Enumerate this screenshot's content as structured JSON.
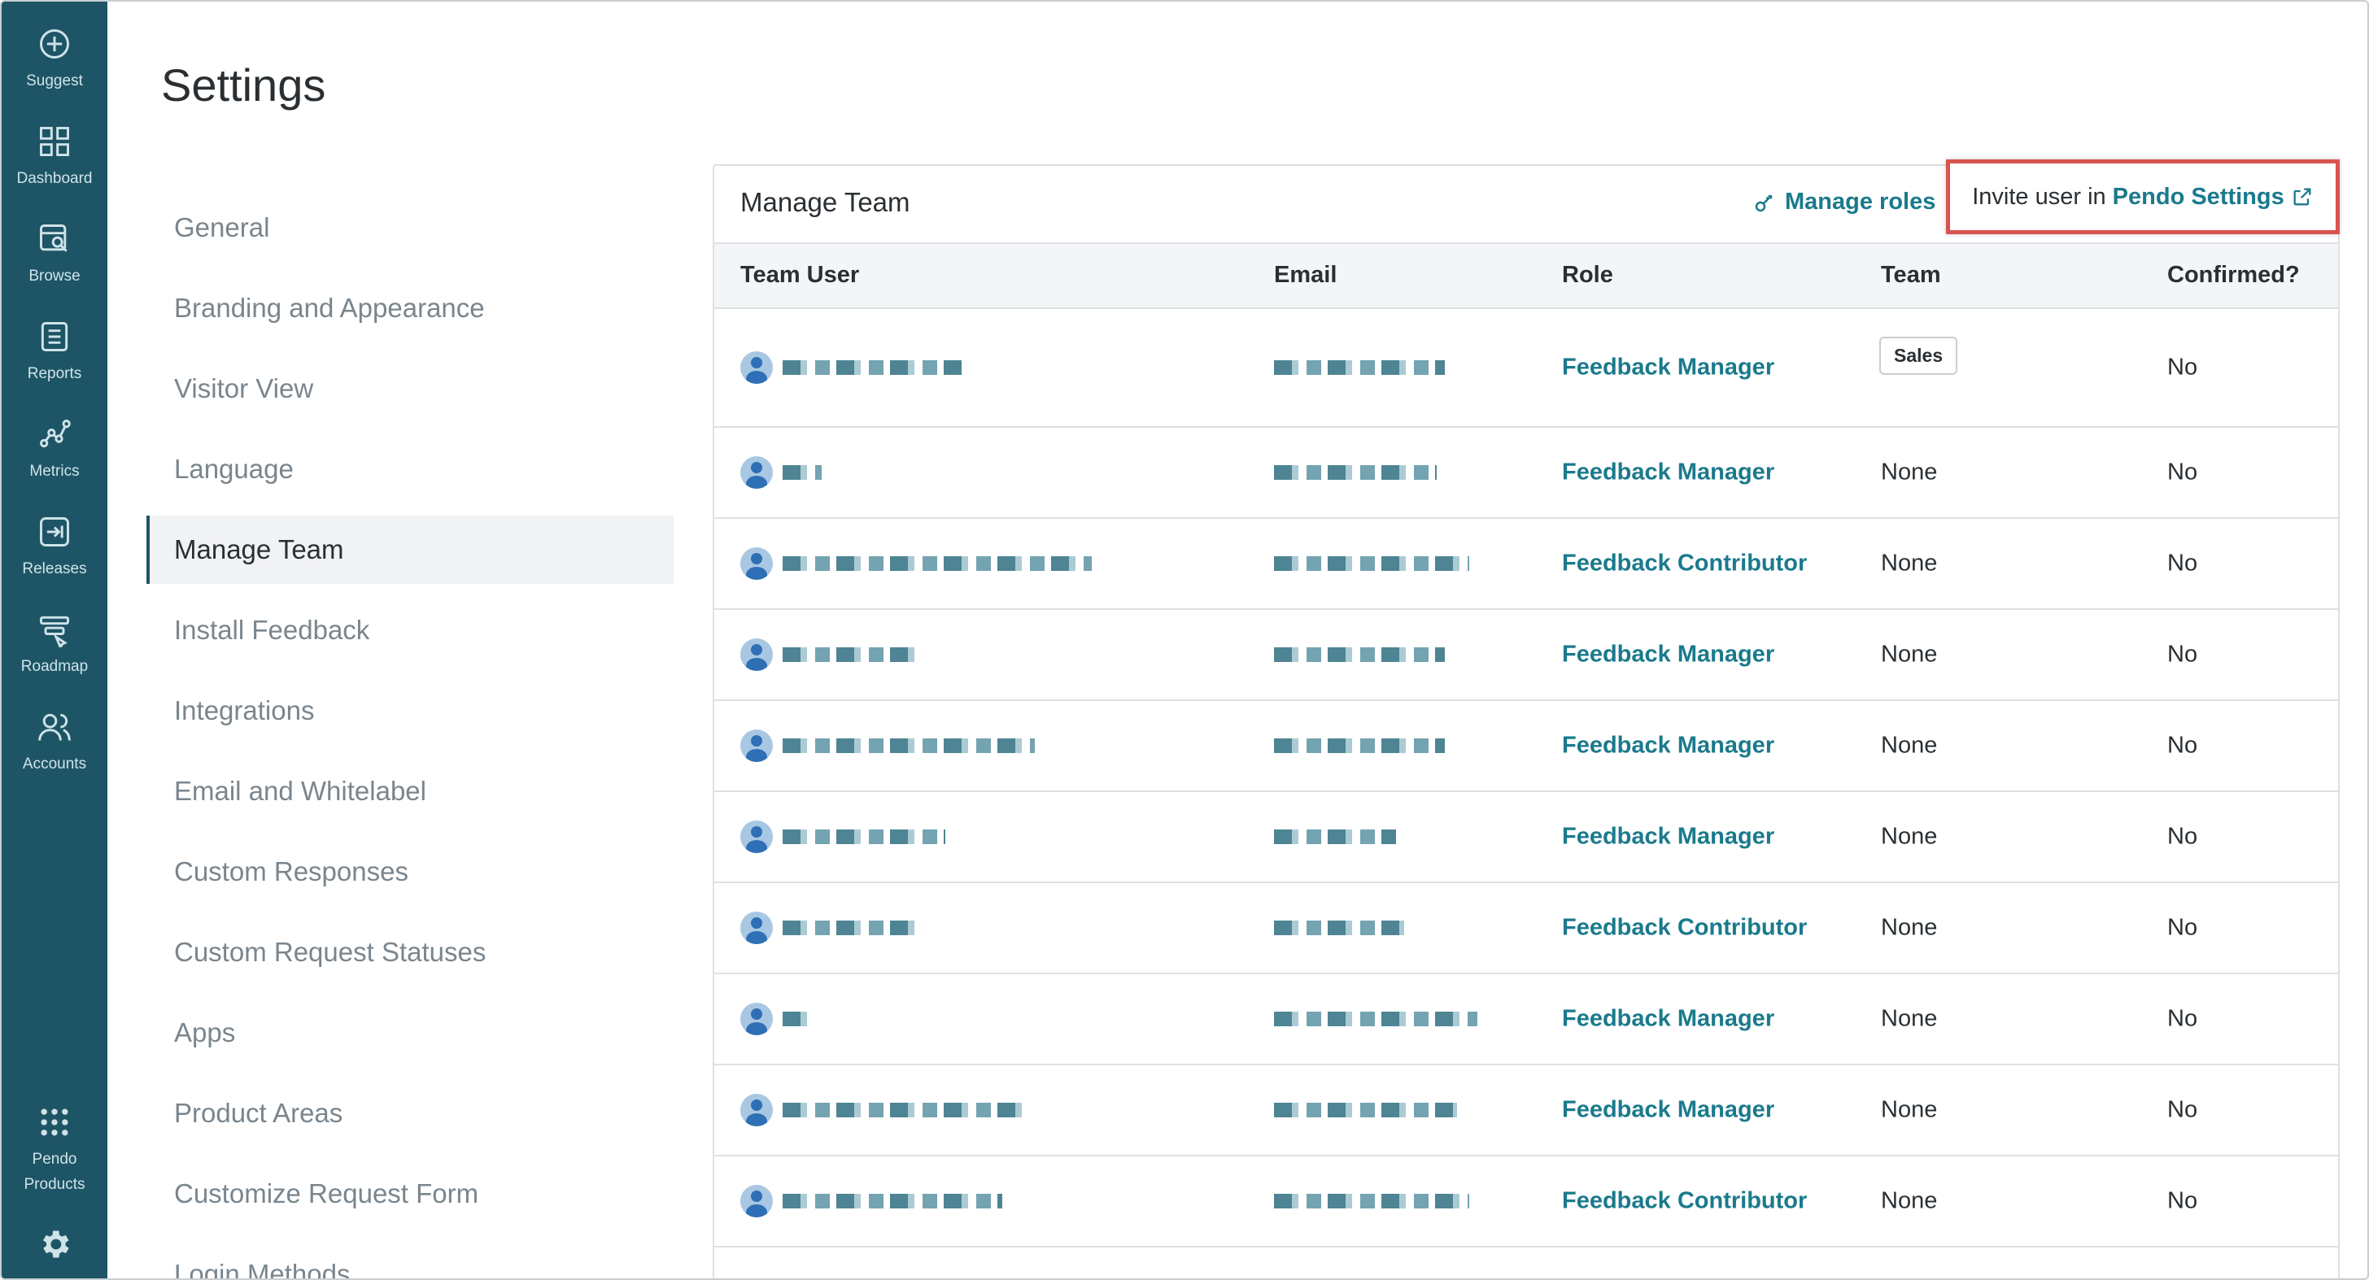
{
  "rail": {
    "items": [
      {
        "label": "Suggest",
        "icon": "plus-circle-icon"
      },
      {
        "label": "Dashboard",
        "icon": "grid-icon"
      },
      {
        "label": "Browse",
        "icon": "browse-icon"
      },
      {
        "label": "Reports",
        "icon": "reports-icon"
      },
      {
        "label": "Metrics",
        "icon": "metrics-icon"
      },
      {
        "label": "Releases",
        "icon": "releases-icon"
      },
      {
        "label": "Roadmap",
        "icon": "roadmap-icon"
      },
      {
        "label": "Accounts",
        "icon": "accounts-icon"
      }
    ],
    "pendo_products": {
      "line1": "Pendo",
      "line2": "Products",
      "icon": "dots-grid-icon"
    },
    "settings_icon": "gear-icon"
  },
  "page": {
    "title": "Settings"
  },
  "nav": {
    "items": [
      "General",
      "Branding and Appearance",
      "Visitor View",
      "Language",
      "Manage Team",
      "Install Feedback",
      "Integrations",
      "Email and Whitelabel",
      "Custom Responses",
      "Custom Request Statuses",
      "Apps",
      "Product Areas",
      "Customize Request Form",
      "Login Methods"
    ],
    "active": "Manage Team"
  },
  "panel": {
    "title": "Manage Team",
    "manage_roles": "Manage roles",
    "invite_text": "Invite user in",
    "invite_link": "Pendo Settings",
    "columns": {
      "user": "Team User",
      "email": "Email",
      "role": "Role",
      "team": "Team",
      "confirmed": "Confirmed?"
    },
    "rows": [
      {
        "role": "Feedback Manager",
        "team": "Sales",
        "confirmed": "No"
      },
      {
        "role": "Feedback Manager",
        "team": "None",
        "confirmed": "No"
      },
      {
        "role": "Feedback Contributor",
        "team": "None",
        "confirmed": "No"
      },
      {
        "role": "Feedback Manager",
        "team": "None",
        "confirmed": "No"
      },
      {
        "role": "Feedback Manager",
        "team": "None",
        "confirmed": "No"
      },
      {
        "role": "Feedback Manager",
        "team": "None",
        "confirmed": "No"
      },
      {
        "role": "Feedback Contributor",
        "team": "None",
        "confirmed": "No"
      },
      {
        "role": "Feedback Manager",
        "team": "None",
        "confirmed": "No"
      },
      {
        "role": "Feedback Manager",
        "team": "None",
        "confirmed": "No"
      },
      {
        "role": "Feedback Contributor",
        "team": "None",
        "confirmed": "No"
      }
    ]
  },
  "colors": {
    "rail": "#1e5566",
    "accent": "#1a7a8c",
    "highlight": "#d9534f"
  }
}
